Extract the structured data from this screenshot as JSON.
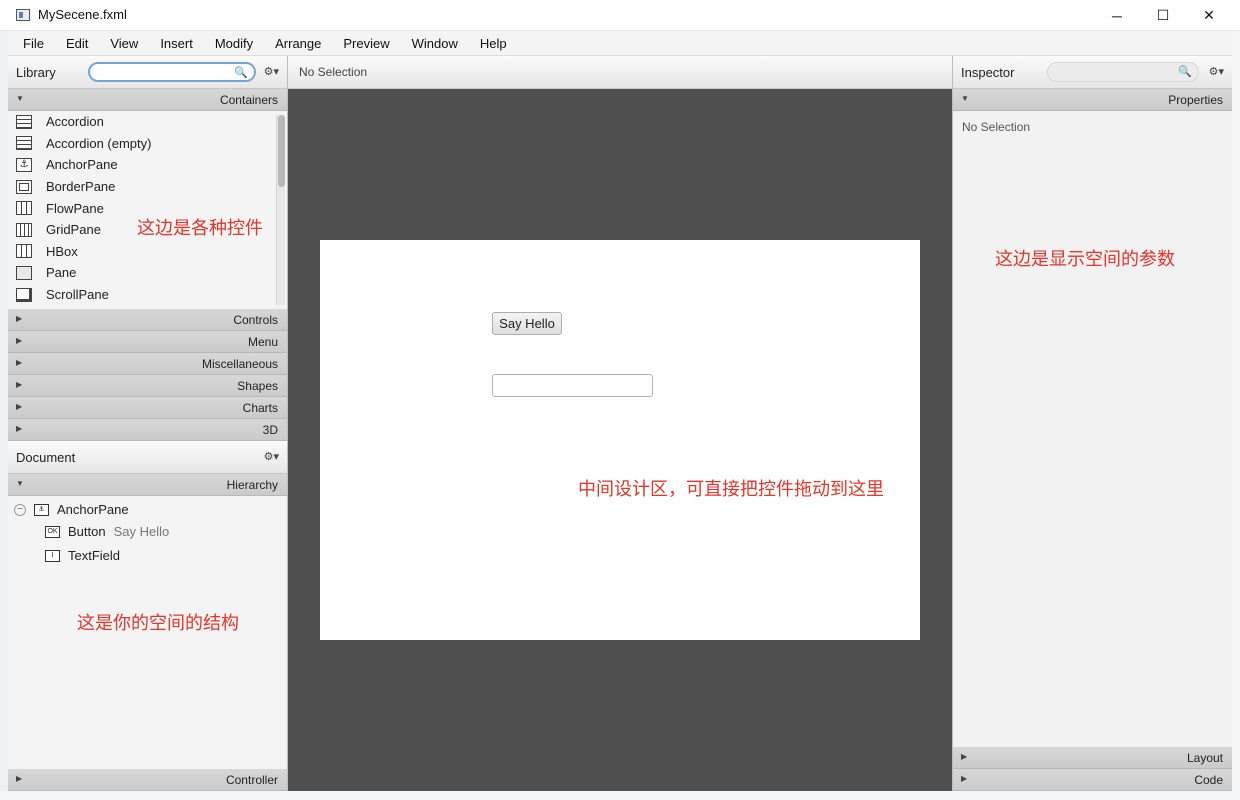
{
  "window": {
    "title": "MySecene.fxml",
    "controls": {
      "minimize": "─",
      "maximize": "☐",
      "close": "✕"
    }
  },
  "menu": [
    "File",
    "Edit",
    "View",
    "Insert",
    "Modify",
    "Arrange",
    "Preview",
    "Window",
    "Help"
  ],
  "library": {
    "title": "Library",
    "search_value": "",
    "section": "Containers",
    "items": [
      {
        "label": "Accordion",
        "icon": "accordion-icon"
      },
      {
        "label": "Accordion  (empty)",
        "icon": "accordion-icon"
      },
      {
        "label": "AnchorPane",
        "icon": "anchor-icon"
      },
      {
        "label": "BorderPane",
        "icon": "borderpane-icon"
      },
      {
        "label": "FlowPane",
        "icon": "flowpane-icon"
      },
      {
        "label": "GridPane",
        "icon": "grid-icon"
      },
      {
        "label": "HBox",
        "icon": "hbox-icon"
      },
      {
        "label": "Pane",
        "icon": "pane-icon"
      },
      {
        "label": "ScrollPane",
        "icon": "scrollpane-icon"
      }
    ],
    "collapsed_sections": [
      "Controls",
      "Menu",
      "Miscellaneous",
      "Shapes",
      "Charts",
      "3D"
    ]
  },
  "document": {
    "title": "Document",
    "section": "Hierarchy",
    "tree": {
      "root": "AnchorPane",
      "children": [
        {
          "type": "Button",
          "text": "Say Hello",
          "icon_text": "OK"
        },
        {
          "type": "TextField",
          "text": "",
          "icon_text": "I"
        }
      ]
    },
    "controller_label": "Controller"
  },
  "canvas": {
    "selection": "No Selection",
    "button_label": "Say Hello",
    "textfield_value": ""
  },
  "inspector": {
    "title": "Inspector",
    "search_value": "",
    "section": "Properties",
    "selection": "No Selection",
    "bottom_sections": [
      "Layout",
      "Code"
    ]
  },
  "annotations": {
    "library": "这边是各种控件",
    "inspector": "这边是显示空间的参数",
    "canvas": "中间设计区，可直接把控件拖动到这里",
    "hierarchy": "这是你的空间的结构"
  },
  "colors": {
    "annotation": "#e0362c",
    "canvas_bg": "#4f4f4f",
    "search_focus": "#76a6d8"
  }
}
